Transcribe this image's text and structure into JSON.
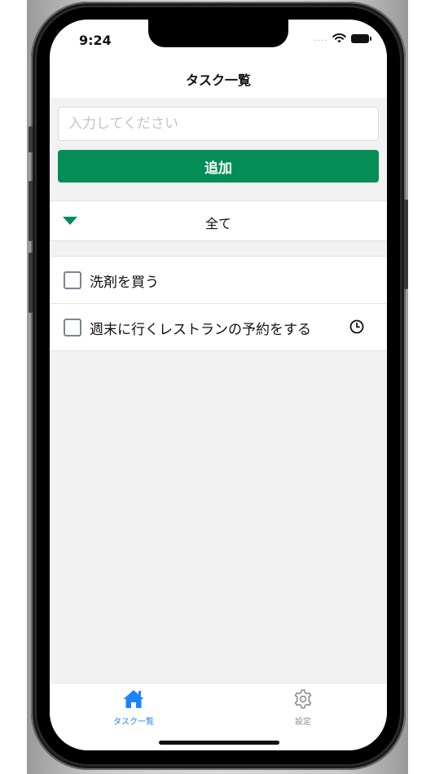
{
  "status_bar": {
    "time": "9:24",
    "signal_dots": "....",
    "icons": [
      "wifi-icon",
      "battery-icon"
    ]
  },
  "header": {
    "title": "タスク一覧"
  },
  "add_form": {
    "input_value": "",
    "input_placeholder": "入力してください",
    "add_button_label": "追加"
  },
  "filter": {
    "selected": "全て",
    "icon": "caret-down-icon"
  },
  "tasks": [
    {
      "title": "洗剤を買う",
      "checked": false,
      "has_reminder": false
    },
    {
      "title": "週末に行くレストランの予約をする",
      "checked": false,
      "has_reminder": true
    }
  ],
  "tab_bar": {
    "items": [
      {
        "label": "タスク一覧",
        "icon": "home-icon",
        "active": true
      },
      {
        "label": "設定",
        "icon": "gear-icon",
        "active": false
      }
    ]
  },
  "colors": {
    "accent_green": "#048d56",
    "active_tab_blue": "#1a84ff",
    "inactive_tab_gray": "#8e8e93",
    "screen_background": "#f2f2f2"
  }
}
